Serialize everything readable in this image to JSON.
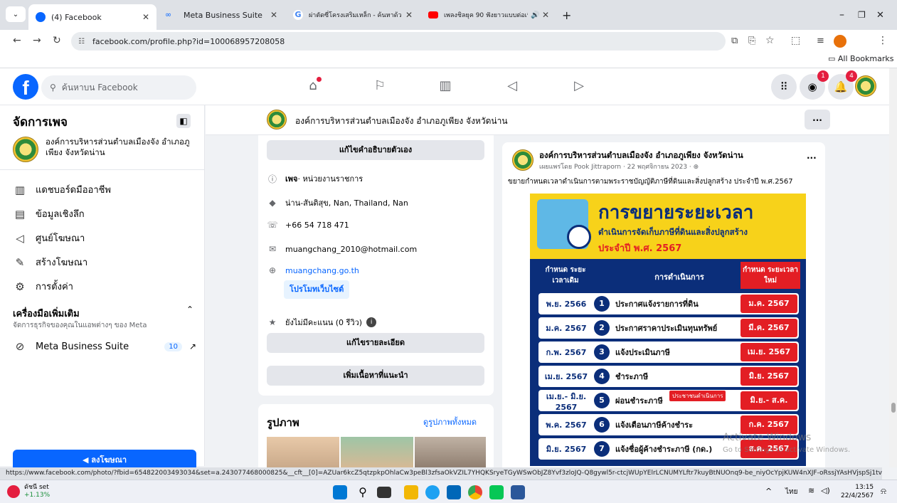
{
  "browser": {
    "tabs": [
      {
        "title": "(4) Facebook",
        "active": true
      },
      {
        "title": "Meta Business Suite"
      },
      {
        "title": "ผ่าตัดซี่โครงเสริมเหล็ก - ค้นหาด้วย G"
      },
      {
        "title": "เพลงชิลยุค 90 ฟังยาวแบบต่อเนื่อง"
      }
    ],
    "new_tab": "+",
    "url": "facebook.com/profile.php?id=100068957208058",
    "bookmarks_label": "All Bookmarks",
    "status_url": "https://www.facebook.com/photo/?fbid=654822003493034&set=a.243077468000825&__cft__[0]=AZUar6kcZ5qtzpkpOhlaCw3peBl3zfsaOkVZIL7YHQKSryeTGyWSwObJZ8Yvf3zloJQ-Q8gywl5r-ctcjWUpYElrLCNUMYLftr7kuyBtNUOnq9-be_niyOcYpjKUW4nXJF-oRssjYAsHVjspSj1tvzlnBM5byW-t33i8..."
  },
  "fb_header": {
    "search_placeholder": "ค้นหาบน Facebook",
    "messenger_badge": "1",
    "notifications_badge": "4"
  },
  "sidebar": {
    "title": "จัดการเพจ",
    "page_name": "องค์การบริหารส่วนตำบลเมืองจัง อำเภอภูเพียง จังหวัดน่าน",
    "items": [
      {
        "label": "แดชบอร์ดมืออาชีพ",
        "icon": "dashboard-icon"
      },
      {
        "label": "ข้อมูลเชิงลึก",
        "icon": "insights-icon"
      },
      {
        "label": "ศูนย์โฆษณา",
        "icon": "megaphone-icon"
      },
      {
        "label": "สร้างโฆษณา",
        "icon": "pencil-icon"
      },
      {
        "label": "การตั้งค่า",
        "icon": "gear-icon"
      }
    ],
    "tools_title": "เครื่องมือเพิ่มเติม",
    "tools_subtitle": "จัดการธุรกิจของคุณในแอพต่างๆ ของ Meta",
    "mbs_label": "Meta Business Suite",
    "mbs_count": "10",
    "promote_button": "ลงโฆษณา"
  },
  "page_bar": {
    "name": "องค์การบริหารส่วนตำบลเมืองจัง อำเภอภูเพียง จังหวัดน่าน",
    "more": "..."
  },
  "intro": {
    "edit_bio": "แก้ไขคำอธิบายตัวเอง",
    "category_prefix": "เพจ",
    "category": " · หน่วยงานราชการ",
    "address": "น่าน-สันติสุข, Nan, Thailand, Nan",
    "phone": "+66 54 718 471",
    "email": "muangchang_2010@hotmail.com",
    "website": "muangchang.go.th",
    "promote_website": "โปรโมทเว็บไซต์",
    "rating": "ยังไม่มีคะแนน (0 รีวิว)",
    "edit_details": "แก้ไขรายละเอียด",
    "add_featured": "เพิ่มเนื้อหาที่แนะนำ",
    "photos_title": "รูปภาพ",
    "see_all_photos": "ดูรูปภาพทั้งหมด"
  },
  "post": {
    "author": "องค์การบริหารส่วนตำบลเมืองจัง อำเภอภูเพียง จังหวัดน่าน",
    "meta": "เผยแพร่โดย Pook Jittraporn · 22 พฤศจิกายน 2023 ·",
    "more": "...",
    "text": "ขยายกำหนดเวลาดำเนินการตามพระราชบัญญัติภาษีที่ดินและสิ่งปลูกสร้าง ประจำปี พ.ศ.2567",
    "poster": {
      "headline": "การขยายระยะเวลา",
      "subline1": "ดำเนินการจัดเก็บภาษีที่ดินและสิ่งปลูกสร้าง",
      "subline2": "ประจำปี พ.ศ. 2567",
      "col1": "กำหนด ระยะเวลาเดิม",
      "col2": "การดำเนินการ",
      "col3": "กำหนด ระยะเวลาใหม่",
      "note": "ประชาชนดำเนินการ",
      "rows": [
        {
          "old": "พ.ย. 2566",
          "n": "1",
          "action": "ประกาศแจ้งรายการที่ดิน",
          "new": "ม.ค. 2567"
        },
        {
          "old": "ม.ค. 2567",
          "n": "2",
          "action": "ประกาศราคาประเมินทุนทรัพย์",
          "new": "มี.ค. 2567"
        },
        {
          "old": "ก.พ. 2567",
          "n": "3",
          "action": "แจ้งประเมินภาษี",
          "new": "เม.ย. 2567"
        },
        {
          "old": "เม.ย. 2567",
          "n": "4",
          "action": "ชำระภาษี",
          "new": "มิ.ย. 2567"
        },
        {
          "old": "เม.ย.- มิ.ย. 2567",
          "n": "5",
          "action": "ผ่อนชำระภาษี",
          "new": "มิ.ย.- ส.ค. 2567"
        },
        {
          "old": "พ.ค. 2567",
          "n": "6",
          "action": "แจ้งเตือนภาษีค้างชำระ",
          "new": "ก.ค. 2567"
        },
        {
          "old": "มิ.ย. 2567",
          "n": "7",
          "action": "แจ้งชื่อผู้ค้างชำระภาษี (กด.)",
          "new": "ส.ค. 2567"
        }
      ]
    }
  },
  "watermark": {
    "line1": "Activate Windows",
    "line2": "Go to Settings to activate Windows."
  },
  "taskbar": {
    "weather_title": "ดัชนี set",
    "weather_value": "+1.13%",
    "lang": "ไทย",
    "time": "13:15",
    "date": "22/4/2567"
  }
}
